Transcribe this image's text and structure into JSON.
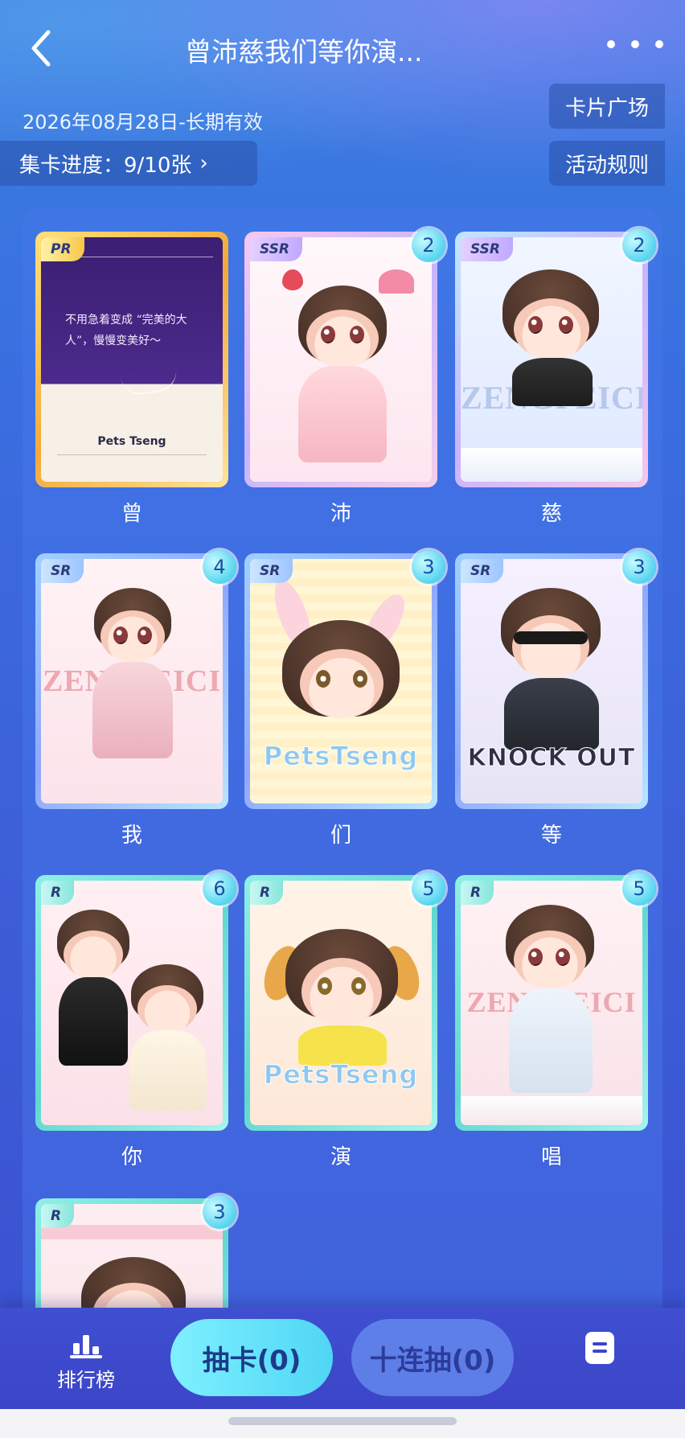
{
  "header": {
    "title": "曾沛慈我们等你演...",
    "date": "2026年08月28日-长期有效",
    "square_label": "卡片广场",
    "rules_label": "活动规则",
    "progress_label": "集卡进度：9/10张",
    "progress_chevron": "›"
  },
  "cards": [
    {
      "rarity": "PR",
      "count": "",
      "label": "曾",
      "name_text": "Pets Tseng",
      "quote": "不用急着变成 “完美的大人”，慢慢变美好～"
    },
    {
      "rarity": "SSR",
      "count": "2",
      "label": "沛"
    },
    {
      "rarity": "SSR",
      "count": "2",
      "label": "慈",
      "art_text": "ZENGPEICI"
    },
    {
      "rarity": "SR",
      "count": "4",
      "label": "我",
      "art_text": "ZENGPEICI"
    },
    {
      "rarity": "SR",
      "count": "3",
      "label": "们",
      "art_text": "PetsTseng"
    },
    {
      "rarity": "SR",
      "count": "3",
      "label": "等",
      "art_text": "KNOCK OUT"
    },
    {
      "rarity": "R",
      "count": "6",
      "label": "你"
    },
    {
      "rarity": "R",
      "count": "5",
      "label": "演",
      "art_text": "PetsTseng"
    },
    {
      "rarity": "R",
      "count": "5",
      "label": "唱",
      "art_text": "ZENGPEICI"
    },
    {
      "rarity": "R",
      "count": "3",
      "label": ""
    }
  ],
  "bottom": {
    "rank_label": "排行榜",
    "draw_label": "抽卡(0)",
    "ten_draw_label": "十连抽(0)"
  },
  "colors": {
    "accent": "#4fd6f5",
    "pr_frame": "#f6c64a",
    "ssr_frame": "#d9b8f5",
    "sr_frame": "#7fb0f0",
    "r_frame": "#6fe3d6"
  }
}
